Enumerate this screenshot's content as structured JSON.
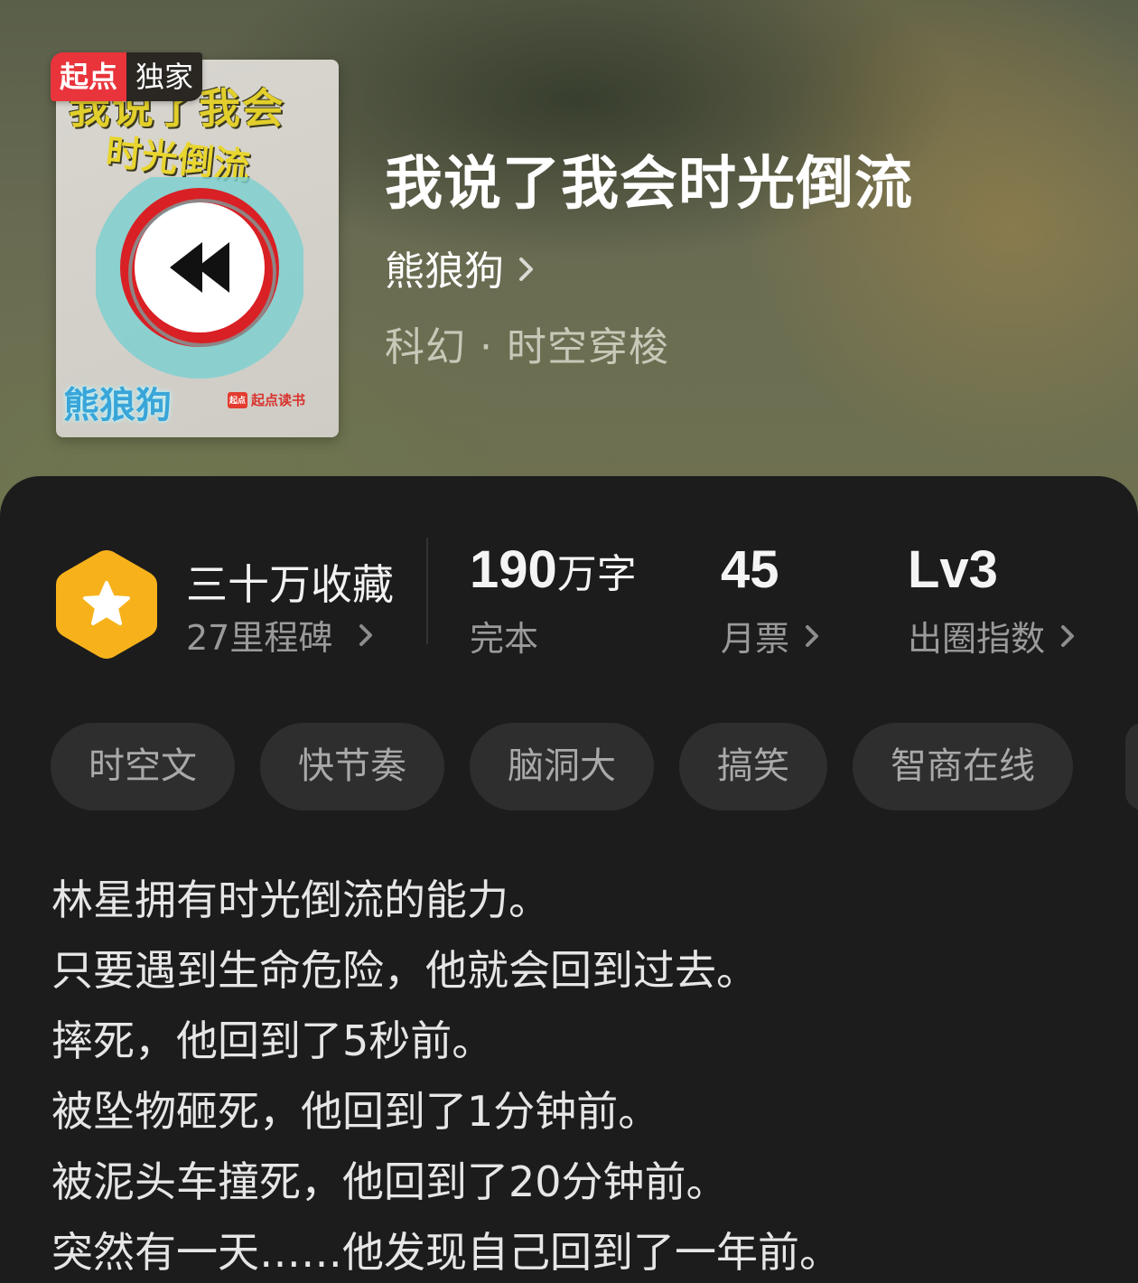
{
  "badge": {
    "brand": "起点",
    "label": "独家"
  },
  "cover": {
    "title_line1": "我说了我会",
    "title_line2": "时光倒流",
    "author": "熊狼狗",
    "brand": "起点读书",
    "brand_mark": "起点"
  },
  "book": {
    "title": "我说了我会时光倒流",
    "author": "熊狼狗",
    "genre": "科幻 · 时空穿梭"
  },
  "stats": {
    "favorites": {
      "label": "三十万收藏",
      "milestones": "27里程碑"
    },
    "words": {
      "value": "190",
      "unit": "万字",
      "status": "完本"
    },
    "monthly_tickets": {
      "value": "45",
      "label": "月票"
    },
    "breakout": {
      "value": "Lv3",
      "label": "出圈指数"
    }
  },
  "tags": [
    "时空文",
    "快节奏",
    "脑洞大",
    "搞笑",
    "智商在线"
  ],
  "description": [
    "林星拥有时光倒流的能力。",
    "只要遇到生命危险，他就会回到过去。",
    "摔死，他回到了5秒前。",
    "被坠物砸死，他回到了1分钟前。",
    "被泥头车撞死，他回到了20分钟前。",
    "突然有一天……他发现自己回到了一年前。"
  ],
  "colors": {
    "accent_badge": "#e9343c",
    "hex_icon": "#f7b21b",
    "sheet_bg": "#1c1c1c",
    "tag_bg": "#2e2e2e"
  },
  "icons": {
    "author_chevron": "chevron-right-icon",
    "favorite_icon": "star-hexagon-icon"
  }
}
